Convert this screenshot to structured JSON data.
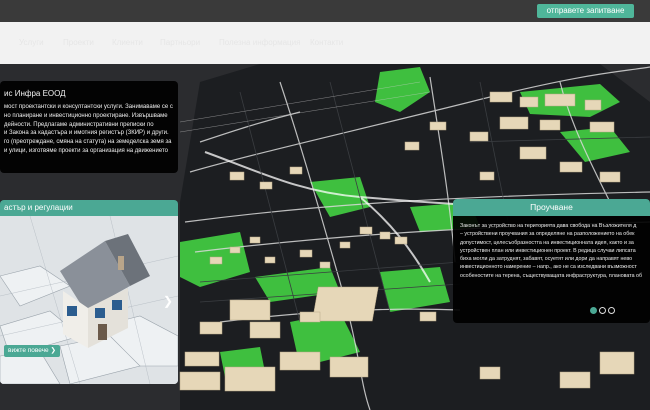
{
  "header": {
    "cta_label": "отправете запитване"
  },
  "nav": {
    "items": [
      "Услуги",
      "Проекти",
      "Клиенти",
      "Партньори",
      "Полезна информация",
      "Контакти"
    ]
  },
  "intro": {
    "title": "ис Инфра ЕООД",
    "body": "мост проектантски и консултантски услуги. Занимаваме се с\nно планиране и инвестиционно проектиране. Извършваме\nдейности. Предлагаме административни преписки по\nи Закона за кадастъра и имотния регистър (ЗКИР) и други.\nго (преотреждане, смяна на статута) на земеделска земя за\nи улици, изготвяме проекти за организация на движението"
  },
  "left_panel": {
    "title": "астър и регулации",
    "more_label": "вижте повече ❯",
    "arrow": "❯"
  },
  "right_card": {
    "title": "Проучване",
    "body": "Законът за устройство на територията дава свобода на Възложителя д\n– устройствени проучвания за определяне на разположението на обек\nдопустимост, целесъобразността на инвестиционната идея, както и за\nустройствен план или инвестиционен проект. В редица случаи липсата\nбиха могли да затруднят, забавят, осуетят или дори да направят нево\nинвестиционното намерение – напр., ако не са изследвани възможност\nособеностите на терена, съществуващата инфраструктура, плановата об",
    "carousel": {
      "count": 3,
      "active": 1
    }
  },
  "colors": {
    "accent": "#4ba894",
    "dark_card": "#000000",
    "map_road": "#1c1e21",
    "map_green": "#3fbf3f",
    "building": "#e6d7b8"
  }
}
